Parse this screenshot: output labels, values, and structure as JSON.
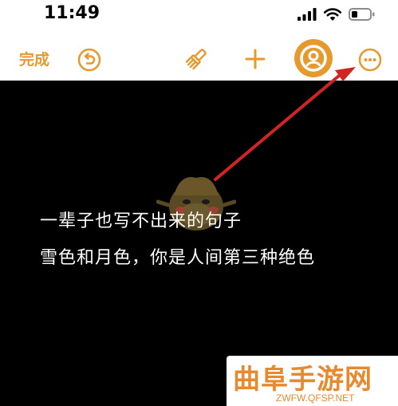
{
  "status_bar": {
    "time": "11:49"
  },
  "toolbar": {
    "done_label": "完成",
    "icons": [
      "undo-icon",
      "brush-icon",
      "plus-icon",
      "collaborator-icon",
      "more-icon"
    ]
  },
  "canvas": {
    "lines": [
      "一辈子也写不出来的句子",
      "雪色和月色，你是人间第三种绝色"
    ]
  },
  "watermark": {
    "title": "曲阜手游网",
    "url": "ZWFW.QFSP.NET"
  },
  "colors": {
    "accent": "#e69a2e",
    "canvas_bg": "#000000",
    "arrow": "#d32424",
    "watermark": "#e8892e"
  }
}
